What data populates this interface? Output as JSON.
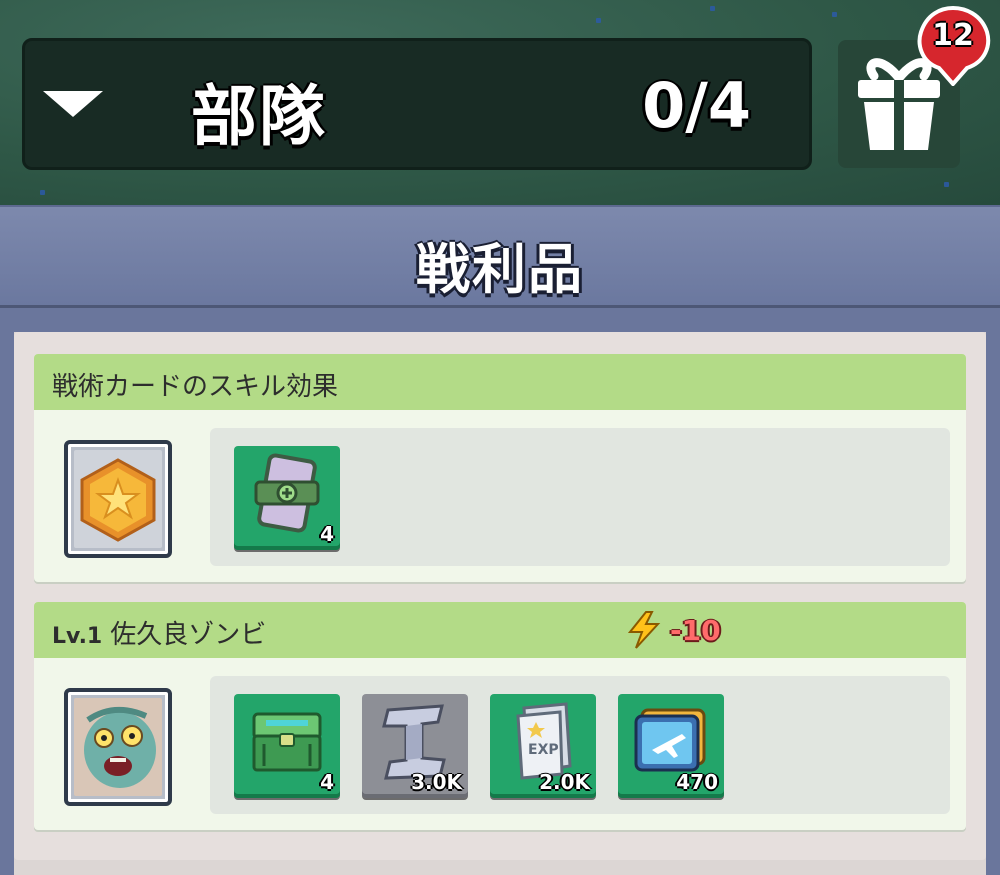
{
  "squad": {
    "title": "部隊",
    "count": "0/4",
    "dropdown_icon": "triangle-down-icon"
  },
  "gift": {
    "icon": "gift-icon",
    "badge_count": "12"
  },
  "header": {
    "title": "戦利品"
  },
  "sections": [
    {
      "title": "戦術カードのスキル効果",
      "portrait_icon": "gold-star-medal-icon",
      "items": [
        {
          "icon": "tactic-card-icon",
          "count": "4"
        }
      ]
    },
    {
      "level": "Lv.1",
      "title": "佐久良ゾンビ",
      "energy_icon": "lightning-icon",
      "energy_cost": "-10",
      "portrait_icon": "zombie-portrait-icon",
      "items": [
        {
          "icon": "supply-chest-icon",
          "count": "4"
        },
        {
          "icon": "steel-beam-icon",
          "count": "3.0K"
        },
        {
          "icon": "exp-book-icon",
          "count": "2.0K"
        },
        {
          "icon": "aircraft-card-icon",
          "count": "470"
        }
      ]
    }
  ],
  "colors": {
    "section_header": "#b3db87",
    "item_bg": "#23a56a",
    "energy_text": "#ff6b6b"
  }
}
